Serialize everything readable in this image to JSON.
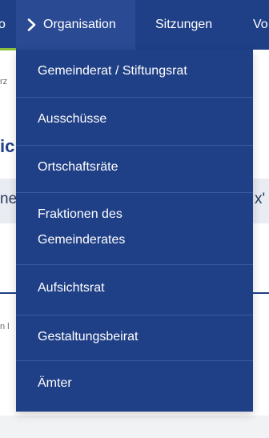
{
  "topnav": {
    "cut_left": "o",
    "organisation": "Organisation",
    "sitzungen": "Sitzungen",
    "cut_right": "Vo"
  },
  "dropdown": {
    "items": [
      {
        "label": "Gemeinderat / Stiftungsrat"
      },
      {
        "label": "Ausschüsse"
      },
      {
        "label": "Ortschaftsräte"
      },
      {
        "label": "Fraktionen des"
      },
      {
        "label": "Gemeinderates"
      },
      {
        "label": "Aufsichtsrat"
      },
      {
        "label": "Gestaltungsbeirat"
      },
      {
        "label": "Ämter"
      }
    ]
  },
  "background": {
    "crumb_fragment": "rz",
    "heading_fragment": "ic",
    "band_left": "ne",
    "band_right": "x'",
    "small_fragment": "n l"
  },
  "colors": {
    "nav_bg": "#1f3f86",
    "nav_active_bg": "#2a4a94",
    "accent_green": "#8bbf3c",
    "text_white": "#ffffff"
  }
}
